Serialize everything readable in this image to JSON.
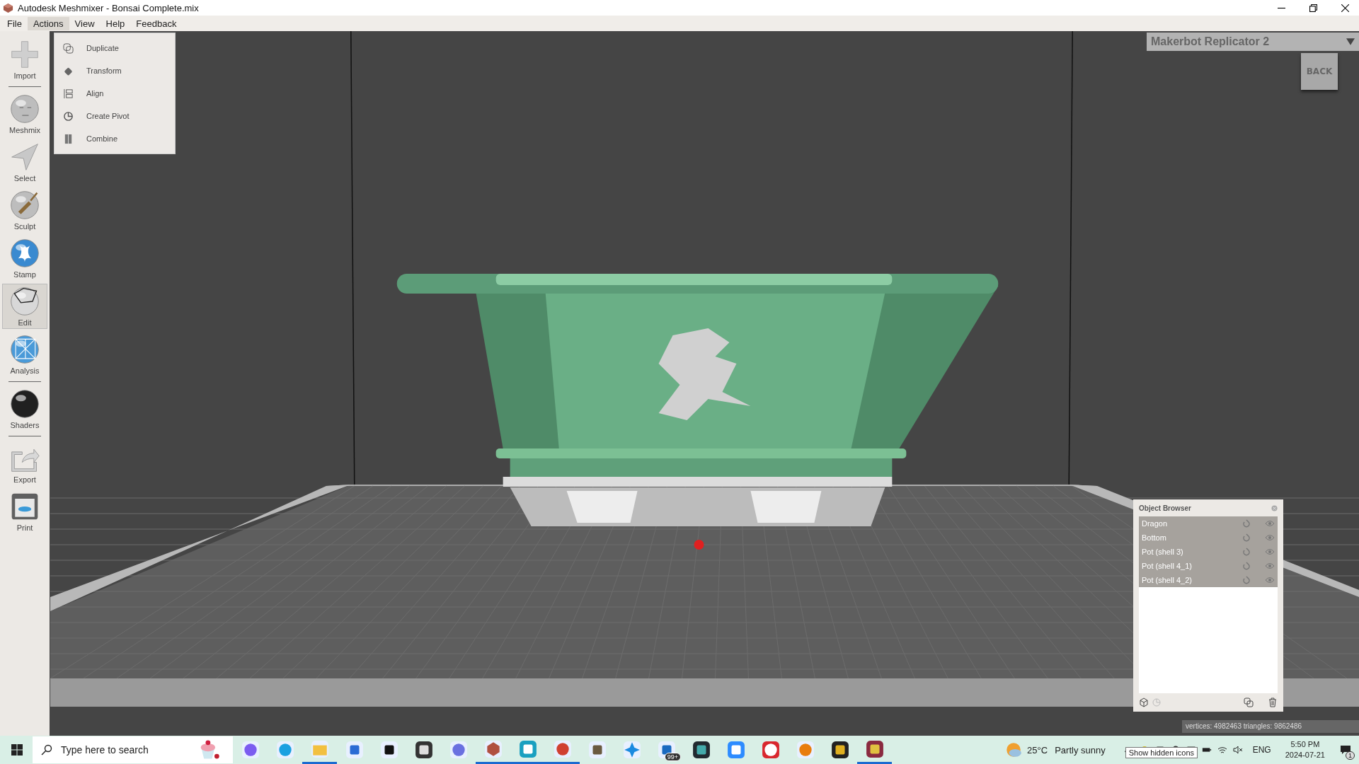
{
  "window": {
    "title": "Autodesk Meshmixer - Bonsai Complete.mix"
  },
  "menu": [
    {
      "label": "File",
      "open": false
    },
    {
      "label": "Actions",
      "open": true
    },
    {
      "label": "View",
      "open": false
    },
    {
      "label": "Help",
      "open": false
    },
    {
      "label": "Feedback",
      "open": false
    }
  ],
  "actions_menu": [
    {
      "label": "Duplicate",
      "kind": "duplicate"
    },
    {
      "label": "Transform",
      "kind": "transform"
    },
    {
      "label": "Align",
      "kind": "align"
    },
    {
      "label": "Create Pivot",
      "kind": "pivot"
    },
    {
      "label": "Combine",
      "kind": "combine"
    }
  ],
  "tools": [
    {
      "label": "Import",
      "kind": "import",
      "selected": false,
      "separator_after": true
    },
    {
      "label": "Meshmix",
      "kind": "meshmix",
      "selected": false,
      "separator_after": false
    },
    {
      "label": "Select",
      "kind": "select",
      "selected": false,
      "separator_after": false
    },
    {
      "label": "Sculpt",
      "kind": "sculpt",
      "selected": false,
      "separator_after": false
    },
    {
      "label": "Stamp",
      "kind": "stamp",
      "selected": false,
      "separator_after": false
    },
    {
      "label": "Edit",
      "kind": "edit",
      "selected": true,
      "separator_after": false
    },
    {
      "label": "Analysis",
      "kind": "analysis",
      "selected": false,
      "separator_after": true
    },
    {
      "label": "Shaders",
      "kind": "shaders",
      "selected": false,
      "separator_after": true
    },
    {
      "label": "Export",
      "kind": "export",
      "selected": false,
      "separator_after": false
    },
    {
      "label": "Print",
      "kind": "print",
      "selected": false,
      "separator_after": false
    }
  ],
  "printer": {
    "name": "Makerbot Replicator 2"
  },
  "back_button": "BACK",
  "object_browser": {
    "title": "Object Browser",
    "objects": [
      {
        "name": "Dragon",
        "selected": true
      },
      {
        "name": "Bottom",
        "selected": true
      },
      {
        "name": "Pot (shell 3)",
        "selected": true
      },
      {
        "name": "Pot (shell 4_1)",
        "selected": true
      },
      {
        "name": "Pot (shell 4_2)",
        "selected": true
      }
    ]
  },
  "status": "vertices: 4982463 triangles: 9862486",
  "taskbar": {
    "search": {
      "placeholder": "Type here to search"
    },
    "apps": [
      {
        "kind": "copilot",
        "running": false
      },
      {
        "kind": "edge",
        "running": false
      },
      {
        "kind": "folder",
        "running": true
      },
      {
        "kind": "store",
        "running": false
      },
      {
        "kind": "dropbox",
        "running": false
      },
      {
        "kind": "notes",
        "running": false
      },
      {
        "kind": "hexagon",
        "running": false
      },
      {
        "kind": "meshmixer",
        "running": true
      },
      {
        "kind": "cura",
        "running": true
      },
      {
        "kind": "chrome",
        "running": true
      },
      {
        "kind": "gimp",
        "running": false
      },
      {
        "kind": "star",
        "running": false
      },
      {
        "kind": "mail",
        "running": false,
        "badge": "99+"
      },
      {
        "kind": "monitor",
        "running": false
      },
      {
        "kind": "video",
        "running": false
      },
      {
        "kind": "mega",
        "running": false
      },
      {
        "kind": "blender",
        "running": false
      },
      {
        "kind": "ds",
        "running": false
      },
      {
        "kind": "archive",
        "running": true
      }
    ],
    "weather": {
      "temperature": "25°C",
      "condition": "Partly sunny"
    },
    "tooltip": "Show hidden icons",
    "language": "ENG",
    "time": "5:50 PM",
    "date": "2024-07-21",
    "notifications": "1"
  }
}
